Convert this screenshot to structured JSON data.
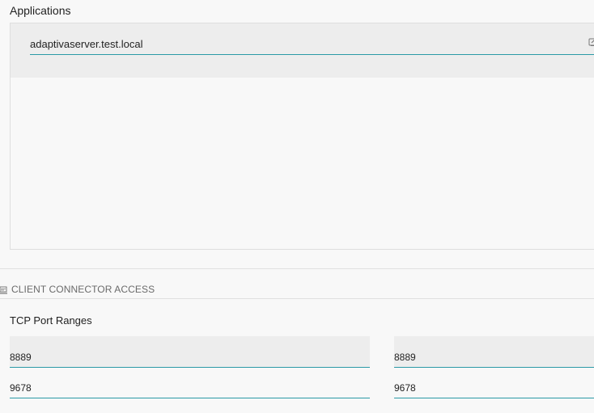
{
  "applications": {
    "label": "Applications",
    "items": [
      {
        "value": "adaptivaserver.test.local",
        "icon": "edit-icon"
      }
    ]
  },
  "client_connector": {
    "header": "CLIENT CONNECTOR ACCESS",
    "icon": "laptop-icon",
    "tcp_label": "TCP Port Ranges",
    "ranges": [
      {
        "start": "8889",
        "end": "8889"
      },
      {
        "start": "9678",
        "end": "9678"
      }
    ]
  },
  "colors": {
    "accent": "#2b9aa6",
    "row_background": "#ededed",
    "page_background": "#f8f8f8"
  }
}
